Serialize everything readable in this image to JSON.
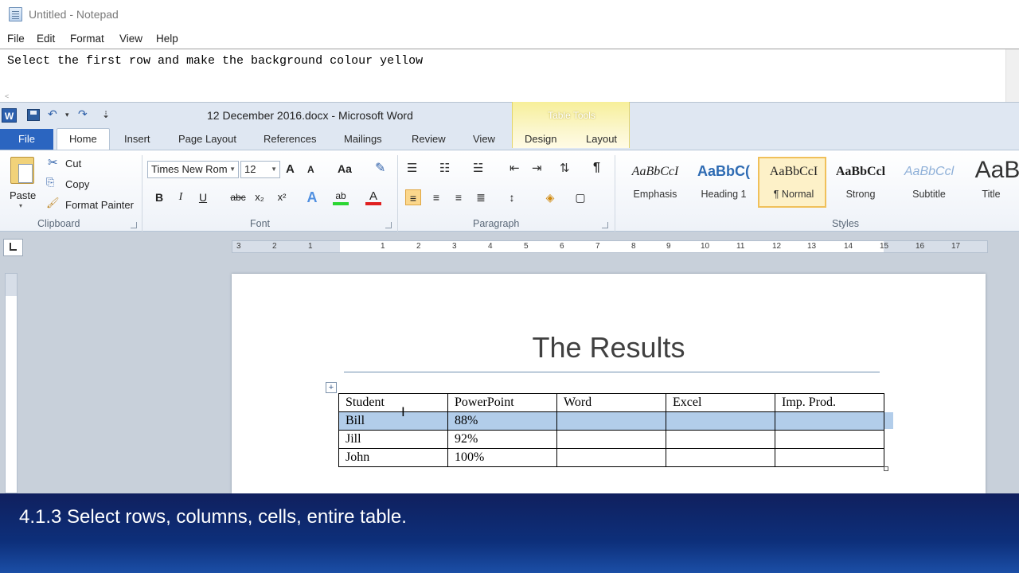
{
  "notepad": {
    "title": "Untitled - Notepad",
    "menu": [
      "File",
      "Edit",
      "Format",
      "View",
      "Help"
    ],
    "text": "Select the first row and make the background colour yellow",
    "scroll_left": "<"
  },
  "word": {
    "logo": "W",
    "qat": {
      "undo": "↶",
      "redo": "↷",
      "customize": "⇣"
    },
    "title": "12 December 2016.docx  -  Microsoft Word",
    "table_tools": "Table Tools",
    "tabs": [
      "File",
      "Home",
      "Insert",
      "Page Layout",
      "References",
      "Mailings",
      "Review",
      "View",
      "Design",
      "Layout"
    ],
    "clipboard": {
      "paste": "Paste",
      "cut": "Cut",
      "copy": "Copy",
      "format_painter": "Format Painter",
      "label": "Clipboard"
    },
    "font": {
      "family": "Times New Rom",
      "size": "12",
      "grow": "A",
      "shrink": "A",
      "case": "Aa",
      "bold": "B",
      "italic": "I",
      "underline": "U",
      "strike": "abc",
      "subscript": "x₂",
      "superscript": "x²",
      "effects": "A",
      "highlight": "ab",
      "color": "A",
      "label": "Font"
    },
    "paragraph": {
      "pilcrow": "¶",
      "label": "Paragraph"
    },
    "styles": {
      "items": [
        {
          "sample": "AaBbCcI",
          "name": "Emphasis"
        },
        {
          "sample": "AaBbC(",
          "name": "Heading 1"
        },
        {
          "sample": "AaBbCcI",
          "name": "¶ Normal"
        },
        {
          "sample": "AaBbCcl",
          "name": "Strong"
        },
        {
          "sample": "AaBbCcl",
          "name": "Subtitle"
        },
        {
          "sample": "AaB",
          "name": "Title"
        }
      ],
      "label": "Styles"
    },
    "ruler_numbers": [
      "3",
      "2",
      "1",
      "1",
      "2",
      "3",
      "4",
      "5",
      "6",
      "7",
      "8",
      "9",
      "10",
      "11",
      "12",
      "13",
      "14",
      "15",
      "16",
      "17"
    ],
    "document": {
      "title": "The Results",
      "table_handle": "+",
      "ibeam": "I",
      "table": [
        [
          "Student",
          "PowerPoint",
          "Word",
          "Excel",
          "Imp. Prod."
        ],
        [
          "Bill",
          "88%",
          "",
          "",
          ""
        ],
        [
          "Jill",
          "92%",
          "",
          "",
          ""
        ],
        [
          "John",
          "100%",
          "",
          "",
          ""
        ]
      ]
    }
  },
  "caption": "4.1.3 Select rows, columns, cells, entire table.",
  "colors": {
    "selection": "#b2cdea",
    "file_tab": "#2b65c0",
    "caption_bg": "#0d2f7a",
    "table_tools": "#f7ef9a"
  }
}
